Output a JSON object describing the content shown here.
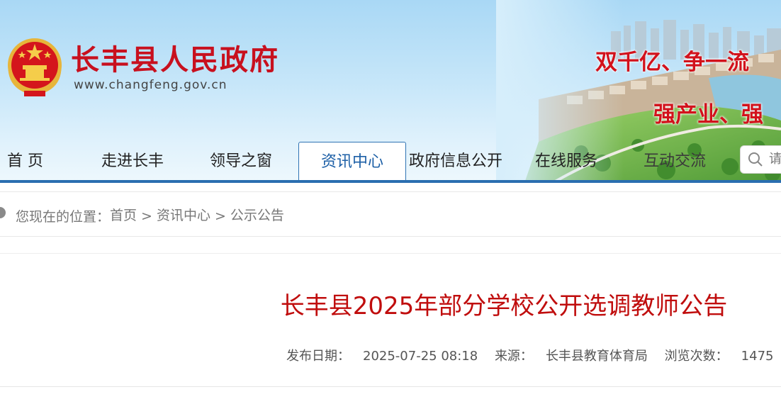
{
  "header": {
    "site_title": "长丰县人民政府",
    "site_url": "www.changfeng.gov.cn",
    "slogan_line1": "双千亿、争一流",
    "slogan_line2": "强产业、强",
    "brand_red": "#c8101e",
    "brand_blue": "#2a6eb0"
  },
  "nav": {
    "items": [
      {
        "label": "首 页"
      },
      {
        "label": "走进长丰"
      },
      {
        "label": "领导之窗"
      },
      {
        "label": "资讯中心",
        "active": true
      },
      {
        "label": "政府信息公开"
      },
      {
        "label": "在线服务"
      },
      {
        "label": "互动交流"
      }
    ],
    "search_placeholder": "请"
  },
  "breadcrumb": {
    "prefix": "您现在的位置：",
    "items": [
      "首页",
      "资讯中心",
      "公示公告"
    ],
    "separator": ">"
  },
  "article": {
    "title": "长丰县2025年部分学校公开选调教师公告",
    "publish_date_label": "发布日期：",
    "publish_date": "2025-07-25 08:18",
    "source_label": "来源：",
    "source": "长丰县教育体育局",
    "views_label": "浏览次数：",
    "views": "1475"
  }
}
